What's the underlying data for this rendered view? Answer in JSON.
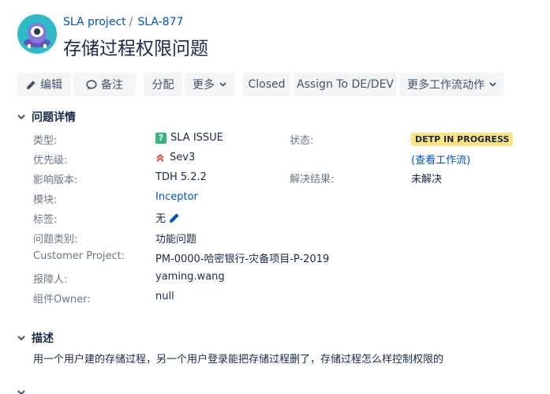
{
  "header": {
    "project_link": "SLA project",
    "separator": "/",
    "issue_key": "SLA-877",
    "title": "存储过程权限问题"
  },
  "toolbar": {
    "edit_label": "编辑",
    "comment_label": "备注",
    "assign_label": "分配",
    "more_label": "更多",
    "closed_label": "Closed",
    "assign_to_label": "Assign To DE/DEV",
    "more_workflow_label": "更多工作流动作"
  },
  "details": {
    "section_title": "问题详情",
    "fields": [
      {
        "label": "类型:",
        "value": "SLA ISSUE"
      },
      {
        "label": "优先级:",
        "value": "Sev3"
      },
      {
        "label": "影响版本:",
        "value": "TDH 5.2.2"
      },
      {
        "label": "模块:",
        "value": "Inceptor"
      },
      {
        "label": "标签:",
        "value": "无"
      },
      {
        "label": "问题类别:",
        "value": "功能问题"
      },
      {
        "label": "Customer Project:",
        "value": "PM-0000-哈密银行-灾备项目-P-2019"
      },
      {
        "label": "报障人:",
        "value": "yaming.wang"
      },
      {
        "label": "组件Owner:",
        "value": "null"
      }
    ],
    "status_label": "状态:",
    "status_value": "DETP IN PROGRESS",
    "view_workflow": "(查看工作流)",
    "resolution_label": "解决结果:",
    "resolution_value": "未解决"
  },
  "description": {
    "section_title": "描述",
    "text": "用一个用户建的存储过程，另一个用户登录能把存储过程删了，存储过程怎么样控制权限的"
  },
  "colors": {
    "link": "#0052cc",
    "button_bg": "#f4f5f7",
    "status_bg": "#ffe380",
    "type_icon": "#36b37e",
    "priority": "#e5493a",
    "avatar": "#2ebac6"
  },
  "icons": {
    "avatar": "alien-avatar-icon",
    "edit": "pencil-icon",
    "comment": "speech-bubble-icon",
    "dropdown": "chevron-down-icon",
    "section_toggle": "chevron-down-icon",
    "type": "question-icon",
    "priority": "double-chevron-up-icon",
    "labels_edit": "pencil-icon"
  }
}
